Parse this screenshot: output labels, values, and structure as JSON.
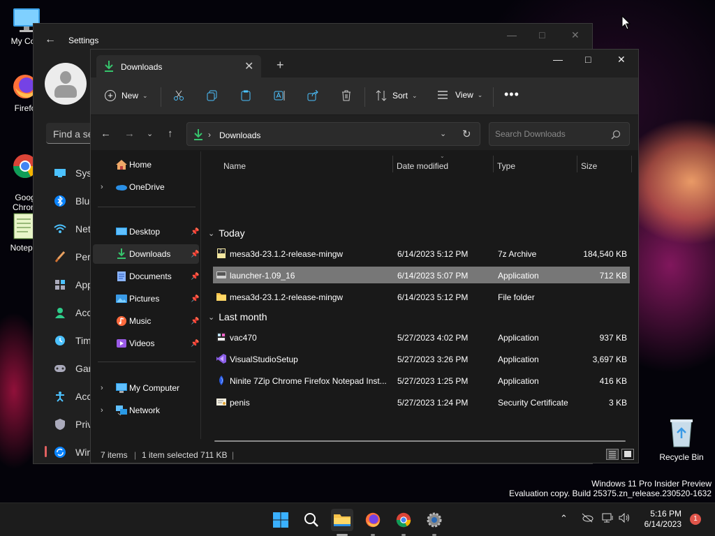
{
  "desktop": {
    "icons": [
      {
        "label": "My Com",
        "icon": "monitor-icon"
      },
      {
        "label": "Firefo",
        "icon": "firefox-icon"
      },
      {
        "label": "Goog\nChrom",
        "icon": "chrome-icon"
      },
      {
        "label": "Notepa",
        "icon": "notepad-icon"
      }
    ],
    "recycle_bin": "Recycle Bin",
    "watermark_line1": "Windows 11 Pro Insider Preview",
    "watermark_line2": "Evaluation copy. Build 25375.zn_release.230520-1632"
  },
  "settings": {
    "title": "Settings",
    "search_placeholder": "Find a se",
    "nav": [
      {
        "label": "Syst",
        "icon": "system-icon"
      },
      {
        "label": "Blue",
        "icon": "bluetooth-icon"
      },
      {
        "label": "Net",
        "icon": "wifi-icon"
      },
      {
        "label": "Pers",
        "icon": "brush-icon"
      },
      {
        "label": "App",
        "icon": "apps-icon"
      },
      {
        "label": "Acc",
        "icon": "accounts-icon"
      },
      {
        "label": "Tim",
        "icon": "time-icon"
      },
      {
        "label": "Gar",
        "icon": "gaming-icon"
      },
      {
        "label": "Acc",
        "icon": "accessibility-icon"
      },
      {
        "label": "Priv",
        "icon": "privacy-icon"
      },
      {
        "label": "Win",
        "icon": "update-icon"
      }
    ]
  },
  "explorer": {
    "tab_title": "Downloads",
    "commands": {
      "new": "New",
      "sort": "Sort",
      "view": "View"
    },
    "address": {
      "crumb": "Downloads"
    },
    "search_placeholder": "Search Downloads",
    "nav_pane": {
      "home": "Home",
      "onedrive": "OneDrive",
      "desktop": "Desktop",
      "downloads": "Downloads",
      "documents": "Documents",
      "pictures": "Pictures",
      "music": "Music",
      "videos": "Videos",
      "my_computer": "My Computer",
      "network": "Network"
    },
    "columns": {
      "name": "Name",
      "date": "Date modified",
      "type": "Type",
      "size": "Size"
    },
    "groups": {
      "today": "Today",
      "last_month": "Last month"
    },
    "files_today": [
      {
        "name": "mesa3d-23.1.2-release-mingw",
        "date": "6/14/2023 5:12 PM",
        "type": "7z Archive",
        "size": "184,540 KB",
        "icon": "archive-icon"
      },
      {
        "name": "launcher-1.09_16",
        "date": "6/14/2023 5:07 PM",
        "type": "Application",
        "size": "712 KB",
        "icon": "app-icon",
        "selected": true
      },
      {
        "name": "mesa3d-23.1.2-release-mingw",
        "date": "6/14/2023 5:12 PM",
        "type": "File folder",
        "size": "",
        "icon": "folder-icon"
      }
    ],
    "files_last_month": [
      {
        "name": "vac470",
        "date": "5/27/2023 4:02 PM",
        "type": "Application",
        "size": "937 KB",
        "icon": "app-icon"
      },
      {
        "name": "VisualStudioSetup",
        "date": "5/27/2023 3:26 PM",
        "type": "Application",
        "size": "3,697 KB",
        "icon": "visual-studio-icon"
      },
      {
        "name": "Ninite 7Zip Chrome Firefox Notepad Inst...",
        "date": "5/27/2023 1:25 PM",
        "type": "Application",
        "size": "416 KB",
        "icon": "ninite-icon"
      },
      {
        "name": "penis",
        "date": "5/27/2023 1:24 PM",
        "type": "Security Certificate",
        "size": "3 KB",
        "icon": "certificate-icon"
      }
    ],
    "status": {
      "items": "7 items",
      "selected": "1 item selected  711 KB"
    }
  },
  "taskbar": {
    "time": "5:16 PM",
    "date": "6/14/2023",
    "notifications": "1"
  },
  "colors": {
    "accent": "#0078d4",
    "selected_row": "#777777",
    "notification": "#e0554a"
  }
}
